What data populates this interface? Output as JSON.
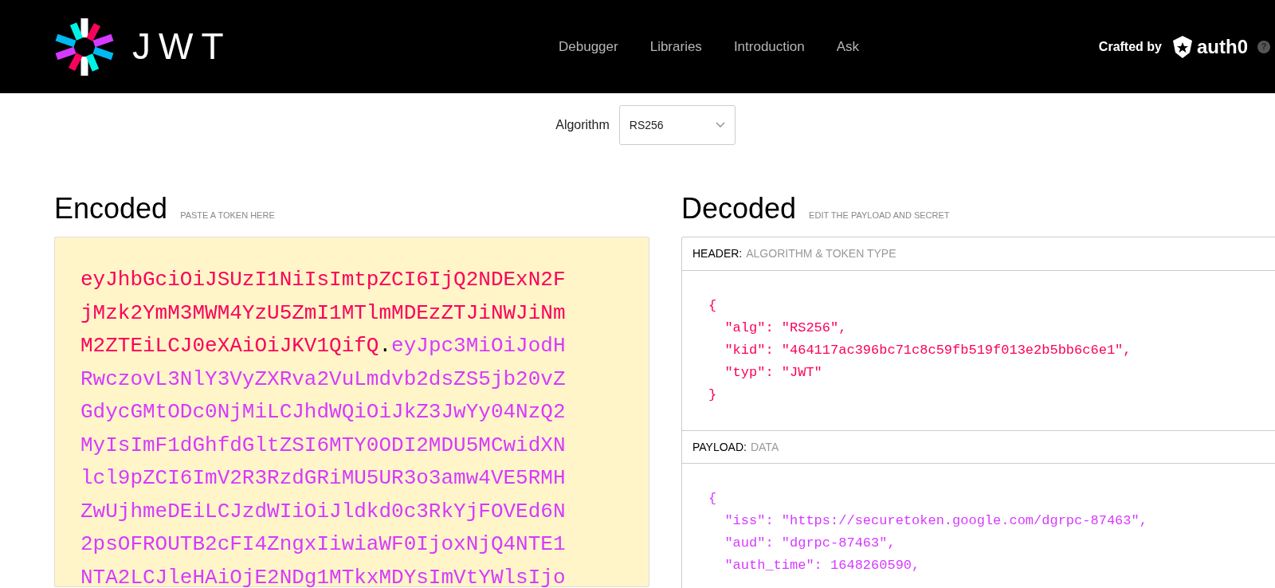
{
  "nav": {
    "logo_text": "JWT",
    "links": [
      "Debugger",
      "Libraries",
      "Introduction",
      "Ask"
    ],
    "crafted_by": "Crafted by",
    "brand": "auth0",
    "help": "?"
  },
  "algorithm": {
    "label": "Algorithm",
    "value": "RS256"
  },
  "encoded": {
    "title": "Encoded",
    "subtitle": "PASTE A TOKEN HERE",
    "token_lines": [
      [
        {
          "kind": "header",
          "text": "eyJhbGciOiJSUzI1NiIsImtpZCI6IjQ2NDExN2F"
        }
      ],
      [
        {
          "kind": "header",
          "text": "jMzk2YmM3MWM4YzU5ZmI1MTlmMDEzZTJiNWJiNm"
        }
      ],
      [
        {
          "kind": "header",
          "text": "M2ZTEiLCJ0eXAiOiJKV1QifQ"
        },
        {
          "kind": "dot",
          "text": "."
        },
        {
          "kind": "payload",
          "text": "eyJpc3MiOiJodH"
        }
      ],
      [
        {
          "kind": "payload",
          "text": "RwczovL3NlY3VyZXRva2VuLmdvb2dsZS5jb20vZ"
        }
      ],
      [
        {
          "kind": "payload",
          "text": "GdycGMtODc0NjMiLCJhdWQiOiJkZ3JwYy04NzQ2"
        }
      ],
      [
        {
          "kind": "payload",
          "text": "MyIsImF1dGhfdGltZSI6MTY0ODI2MDU5MCwidXN"
        }
      ],
      [
        {
          "kind": "payload",
          "text": "lcl9pZCI6ImV2R3RzdGRiMU5UR3o3amw4VE5RMH"
        }
      ],
      [
        {
          "kind": "payload",
          "text": "ZwUjhmeDEiLCJzdWIiOiJldkd0c3RkYjFOVEd6N"
        }
      ],
      [
        {
          "kind": "payload",
          "text": "2psOFROUTB2cFI4ZngxIiwiaWF0IjoxNjQ4NTE1"
        }
      ],
      [
        {
          "kind": "payload",
          "text": "NTA2LCJleHAiOjE2NDg1MTkxMDYsImVtYWlsIjo"
        }
      ]
    ]
  },
  "decoded": {
    "title": "Decoded",
    "subtitle": "EDIT THE PAYLOAD AND SECRET",
    "sections": [
      {
        "kind": "header",
        "label": "HEADER:",
        "sublabel": "ALGORITHM & TOKEN TYPE",
        "lines": [
          "{",
          "  \"alg\": \"RS256\",",
          "  \"kid\": \"464117ac396bc71c8c59fb519f013e2b5bb6c6e1\",",
          "  \"typ\": \"JWT\"",
          "}"
        ]
      },
      {
        "kind": "payload",
        "label": "PAYLOAD:",
        "sublabel": "DATA",
        "lines": [
          "{",
          "  \"iss\": \"https://securetoken.google.com/dgrpc-87463\",",
          "  \"aud\": \"dgrpc-87463\",",
          "  \"auth_time\": 1648260590,"
        ]
      }
    ]
  }
}
